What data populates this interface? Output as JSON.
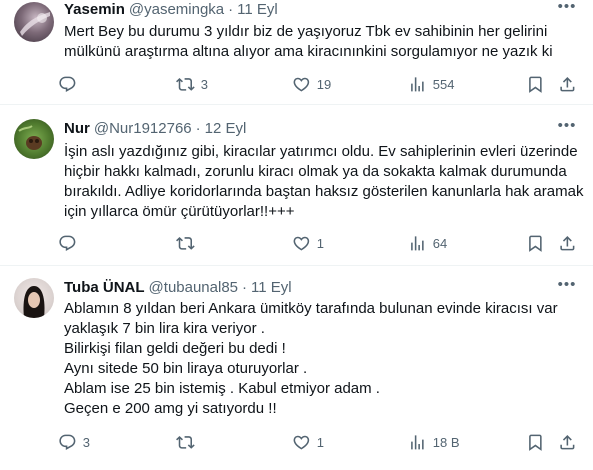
{
  "tweets": [
    {
      "name": "Yasemin",
      "handle": "@yasemingka",
      "separator": "·",
      "date": "11 Eyl",
      "text": "Mert Bey bu durumu 3 yıldır biz de yaşıyoruz Tbk ev sahibinin her gelirini mülkünü araştırma altına alıyor ama kiracınınkini sorgulamıyor ne yazık ki",
      "replies": "",
      "retweets": "3",
      "likes": "19",
      "views": "554"
    },
    {
      "name": "Nur",
      "handle": "@Nur1912766",
      "separator": "·",
      "date": "12 Eyl",
      "text": "İşin aslı yazdığınız gibi, kiracılar yatırımcı oldu. Ev sahiplerinin evleri üzerinde hiçbir hakkı kalmadı, zorunlu kiracı olmak ya da sokakta kalmak durumunda bırakıldı. Adliye koridorlarında baştan haksız gösterilen kanunlarla hak aramak için yıllarca ömür çürütüyorlar!!+++",
      "replies": "",
      "retweets": "",
      "likes": "1",
      "views": "64"
    },
    {
      "name": "Tuba ÜNAL",
      "handle": "@tubaunal85",
      "separator": "·",
      "date": "11 Eyl",
      "text": "Ablamın 8 yıldan beri Ankara ümitköy tarafında bulunan evinde kiracısı var yaklaşık 7 bin lira kira veriyor .\nBilirkişi filan geldi değeri bu dedi !\nAynı sitede 50 bin liraya oturuyorlar .\nAblam ise 25 bin istemiş . Kabul etmiyor adam .\nGeçen e 200 amg yi satıyordu !!",
      "replies": "3",
      "retweets": "",
      "likes": "1",
      "views": "18 B"
    }
  ],
  "icons": {
    "reply": "reply-icon",
    "retweet": "retweet-icon",
    "like": "heart-icon",
    "views": "views-icon",
    "bookmark": "bookmark-icon",
    "share": "share-icon",
    "more": "more-icon"
  },
  "colors": {
    "text": "#0f1419",
    "secondary": "#536471",
    "divider": "#eff3f4"
  }
}
